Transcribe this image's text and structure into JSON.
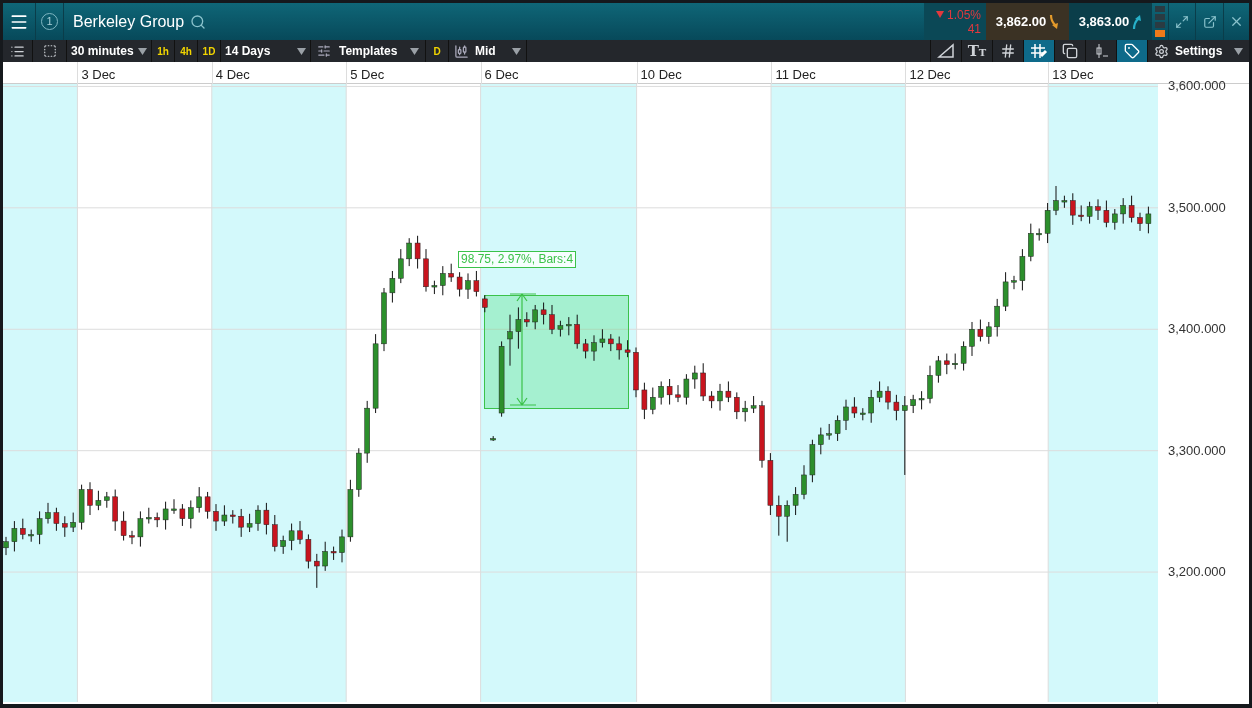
{
  "header": {
    "badge": "1",
    "title": "Berkeley Group",
    "change": {
      "up": false,
      "percent": "1.05%",
      "points": "41"
    },
    "sell": {
      "price": "3,862.00",
      "up": false
    },
    "buy": {
      "price": "3,863.00",
      "up": true
    }
  },
  "toolbar": {
    "interval": "30 minutes",
    "quick_intervals": [
      {
        "label": "1h"
      },
      {
        "label": "4h"
      },
      {
        "label": "1D"
      }
    ],
    "range": "14 Days",
    "templates": "Templates",
    "d_button": "D",
    "price_type": "Mid",
    "tools": [
      {
        "kind": "line",
        "selected": false
      },
      {
        "kind": "text-size",
        "label": "TT",
        "selected": false
      },
      {
        "kind": "grid",
        "selected": false
      },
      {
        "kind": "crosshair",
        "selected": true
      },
      {
        "kind": "layers",
        "selected": false
      },
      {
        "kind": "candle",
        "selected": false
      },
      {
        "kind": "tag",
        "selected": true
      }
    ],
    "settings": "Settings"
  },
  "chart": {
    "measurement": "98.75, 2.97%, Bars:4",
    "chart_data": {
      "type": "candlestick",
      "categories": [
        null,
        null,
        null,
        null,
        null,
        null,
        null,
        null,
        null,
        null,
        null,
        "3 Dec",
        null,
        null,
        null,
        null,
        null,
        null,
        null,
        null,
        null,
        null,
        null,
        null,
        null,
        null,
        null,
        "4 Dec",
        null,
        null,
        null,
        null,
        null,
        null,
        null,
        null,
        null,
        null,
        null,
        null,
        null,
        null,
        null,
        "5 Dec",
        null,
        null,
        null,
        null,
        null,
        null,
        null,
        null,
        null,
        null,
        null,
        null,
        null,
        null,
        null,
        "6 Dec",
        null,
        null,
        null,
        null,
        null,
        null,
        null,
        null,
        null,
        null,
        null,
        null,
        null,
        null,
        null,
        null,
        null,
        null,
        "10 Dec",
        null,
        null,
        null,
        null,
        null,
        null,
        null,
        null,
        null,
        null,
        null,
        null,
        null,
        null,
        null,
        "11 Dec",
        null,
        null,
        null,
        null,
        null,
        null,
        null,
        null,
        null,
        null,
        null,
        null,
        null,
        null,
        null,
        "12 Dec",
        null,
        null,
        null,
        null,
        null,
        null,
        null,
        null,
        null,
        null,
        null,
        null,
        null,
        null,
        null,
        null,
        "13 Dec",
        null,
        null,
        null,
        null,
        null,
        null,
        null,
        null,
        null
      ],
      "grid": true,
      "ohlc": [
        [
          3220,
          3229,
          3214,
          3225
        ],
        [
          3225,
          3242,
          3217,
          3236
        ],
        [
          3236,
          3244,
          3227,
          3231
        ],
        [
          3231,
          3235,
          3225,
          3231
        ],
        [
          3231,
          3250,
          3223,
          3244
        ],
        [
          3244,
          3257,
          3240,
          3249
        ],
        [
          3249,
          3253,
          3234,
          3240
        ],
        [
          3240,
          3246,
          3229,
          3237
        ],
        [
          3237,
          3249,
          3233,
          3241
        ],
        [
          3241,
          3272,
          3235,
          3268
        ],
        [
          3268,
          3274,
          3247,
          3255
        ],
        [
          3255,
          3267,
          3251,
          3259
        ],
        [
          3259,
          3266,
          3253,
          3262
        ],
        [
          3262,
          3268,
          3234,
          3242
        ],
        [
          3242,
          3250,
          3226,
          3230
        ],
        [
          3230,
          3234,
          3223,
          3229
        ],
        [
          3229,
          3250,
          3221,
          3244
        ],
        [
          3244,
          3253,
          3240,
          3245
        ],
        [
          3245,
          3249,
          3237,
          3243
        ],
        [
          3243,
          3258,
          3235,
          3252
        ],
        [
          3252,
          3260,
          3248,
          3252
        ],
        [
          3252,
          3256,
          3238,
          3244
        ],
        [
          3244,
          3259,
          3236,
          3253
        ],
        [
          3253,
          3270,
          3249,
          3262
        ],
        [
          3262,
          3266,
          3244,
          3250
        ],
        [
          3250,
          3256,
          3234,
          3242
        ],
        [
          3242,
          3255,
          3238,
          3247
        ],
        [
          3247,
          3251,
          3240,
          3246
        ],
        [
          3246,
          3252,
          3229,
          3237
        ],
        [
          3237,
          3248,
          3233,
          3240
        ],
        [
          3240,
          3255,
          3234,
          3251
        ],
        [
          3251,
          3257,
          3231,
          3239
        ],
        [
          3239,
          3247,
          3217,
          3221
        ],
        [
          3221,
          3230,
          3215,
          3226
        ],
        [
          3226,
          3240,
          3218,
          3234
        ],
        [
          3234,
          3242,
          3223,
          3227
        ],
        [
          3227,
          3231,
          3203,
          3209
        ],
        [
          3209,
          3215,
          3187,
          3205
        ],
        [
          3205,
          3225,
          3201,
          3217
        ],
        [
          3217,
          3221,
          3210,
          3216
        ],
        [
          3216,
          3235,
          3208,
          3229
        ],
        [
          3229,
          3276,
          3225,
          3268
        ],
        [
          3268,
          3302,
          3262,
          3298
        ],
        [
          3298,
          3341,
          3290,
          3335
        ],
        [
          3335,
          3396,
          3331,
          3388
        ],
        [
          3388,
          3434,
          3382,
          3430
        ],
        [
          3430,
          3448,
          3422,
          3442
        ],
        [
          3442,
          3466,
          3438,
          3458
        ],
        [
          3458,
          3475,
          3452,
          3471
        ],
        [
          3471,
          3477,
          3450,
          3458
        ],
        [
          3458,
          3466,
          3431,
          3435
        ],
        [
          3435,
          3440,
          3429,
          3436
        ],
        [
          3436,
          3452,
          3428,
          3446
        ],
        [
          3446,
          3454,
          3439,
          3443
        ],
        [
          3443,
          3447,
          3427,
          3433
        ],
        [
          3433,
          3446,
          3425,
          3440
        ],
        [
          3440,
          3448,
          3427,
          3431
        ],
        [
          3425,
          3428,
          3414,
          3418
        ],
        [
          3310,
          3312,
          3308,
          3310
        ],
        [
          3331,
          3390,
          3328,
          3386
        ],
        [
          3392,
          3412,
          3370,
          3398
        ],
        [
          3398,
          3418,
          3384,
          3408
        ],
        [
          3408,
          3414,
          3402,
          3406
        ],
        [
          3406,
          3420,
          3400,
          3416
        ],
        [
          3416,
          3422,
          3404,
          3412
        ],
        [
          3412,
          3420,
          3396,
          3400
        ],
        [
          3400,
          3407,
          3394,
          3403
        ],
        [
          3403,
          3410,
          3395,
          3404
        ],
        [
          3404,
          3412,
          3384,
          3388
        ],
        [
          3388,
          3392,
          3376,
          3382
        ],
        [
          3382,
          3395,
          3374,
          3389
        ],
        [
          3389,
          3400,
          3385,
          3392
        ],
        [
          3392,
          3396,
          3382,
          3388
        ],
        [
          3388,
          3394,
          3375,
          3383
        ],
        [
          3383,
          3391,
          3377,
          3381
        ],
        [
          3381,
          3385,
          3344,
          3350
        ],
        [
          3350,
          3356,
          3326,
          3334
        ],
        [
          3334,
          3352,
          3330,
          3344
        ],
        [
          3344,
          3357,
          3338,
          3353
        ],
        [
          3353,
          3359,
          3338,
          3346
        ],
        [
          3346,
          3354,
          3340,
          3344
        ],
        [
          3344,
          3363,
          3338,
          3359
        ],
        [
          3359,
          3370,
          3351,
          3364
        ],
        [
          3364,
          3372,
          3341,
          3345
        ],
        [
          3345,
          3349,
          3335,
          3341
        ],
        [
          3341,
          3355,
          3333,
          3349
        ],
        [
          3349,
          3357,
          3340,
          3344
        ],
        [
          3344,
          3348,
          3326,
          3332
        ],
        [
          3332,
          3341,
          3324,
          3335
        ],
        [
          3335,
          3345,
          3331,
          3337
        ],
        [
          3337,
          3341,
          3286,
          3292
        ],
        [
          3292,
          3298,
          3247,
          3255
        ],
        [
          3255,
          3263,
          3230,
          3246
        ],
        [
          3246,
          3259,
          3225,
          3255
        ],
        [
          3255,
          3270,
          3247,
          3264
        ],
        [
          3264,
          3288,
          3260,
          3280
        ],
        [
          3280,
          3309,
          3274,
          3305
        ],
        [
          3305,
          3319,
          3297,
          3313
        ],
        [
          3313,
          3322,
          3309,
          3314
        ],
        [
          3314,
          3329,
          3308,
          3325
        ],
        [
          3325,
          3342,
          3317,
          3336
        ],
        [
          3336,
          3344,
          3327,
          3331
        ],
        [
          3331,
          3335,
          3325,
          3331
        ],
        [
          3331,
          3350,
          3323,
          3344
        ],
        [
          3344,
          3357,
          3340,
          3349
        ],
        [
          3349,
          3353,
          3334,
          3340
        ],
        [
          3340,
          3346,
          3325,
          3333
        ],
        [
          3333,
          3345,
          3280,
          3337
        ],
        [
          3337,
          3346,
          3331,
          3342
        ],
        [
          3342,
          3349,
          3334,
          3343
        ],
        [
          3343,
          3370,
          3339,
          3362
        ],
        [
          3362,
          3378,
          3356,
          3374
        ],
        [
          3374,
          3380,
          3363,
          3371
        ],
        [
          3371,
          3380,
          3367,
          3372
        ],
        [
          3372,
          3390,
          3366,
          3386
        ],
        [
          3386,
          3406,
          3378,
          3400
        ],
        [
          3400,
          3408,
          3390,
          3394
        ],
        [
          3394,
          3406,
          3388,
          3402
        ],
        [
          3402,
          3425,
          3394,
          3419
        ],
        [
          3419,
          3447,
          3415,
          3439
        ],
        [
          3439,
          3444,
          3433,
          3440
        ],
        [
          3440,
          3466,
          3432,
          3460
        ],
        [
          3460,
          3487,
          3456,
          3479
        ],
        [
          3479,
          3483,
          3473,
          3479
        ],
        [
          3479,
          3504,
          3471,
          3498
        ],
        [
          3498,
          3518,
          3494,
          3506
        ],
        [
          3506,
          3510,
          3500,
          3506
        ],
        [
          3506,
          3512,
          3486,
          3494
        ],
        [
          3494,
          3502,
          3489,
          3493
        ],
        [
          3493,
          3505,
          3487,
          3501
        ],
        [
          3501,
          3507,
          3490,
          3498
        ],
        [
          3498,
          3506,
          3484,
          3488
        ],
        [
          3488,
          3499,
          3482,
          3495
        ],
        [
          3495,
          3508,
          3487,
          3502
        ],
        [
          3502,
          3510,
          3488,
          3492
        ],
        [
          3492,
          3496,
          3481,
          3487
        ],
        [
          3487,
          3501,
          3479,
          3495
        ]
      ],
      "yticks": [
        {
          "value": 3600,
          "label": "3,600.000"
        },
        {
          "value": 3500,
          "label": "3,500.000"
        },
        {
          "value": 3400,
          "label": "3,400.000"
        },
        {
          "value": 3300,
          "label": "3,300.000"
        },
        {
          "value": 3200,
          "label": "3,200.000"
        }
      ],
      "ylim": [
        3093,
        3602
      ]
    }
  }
}
